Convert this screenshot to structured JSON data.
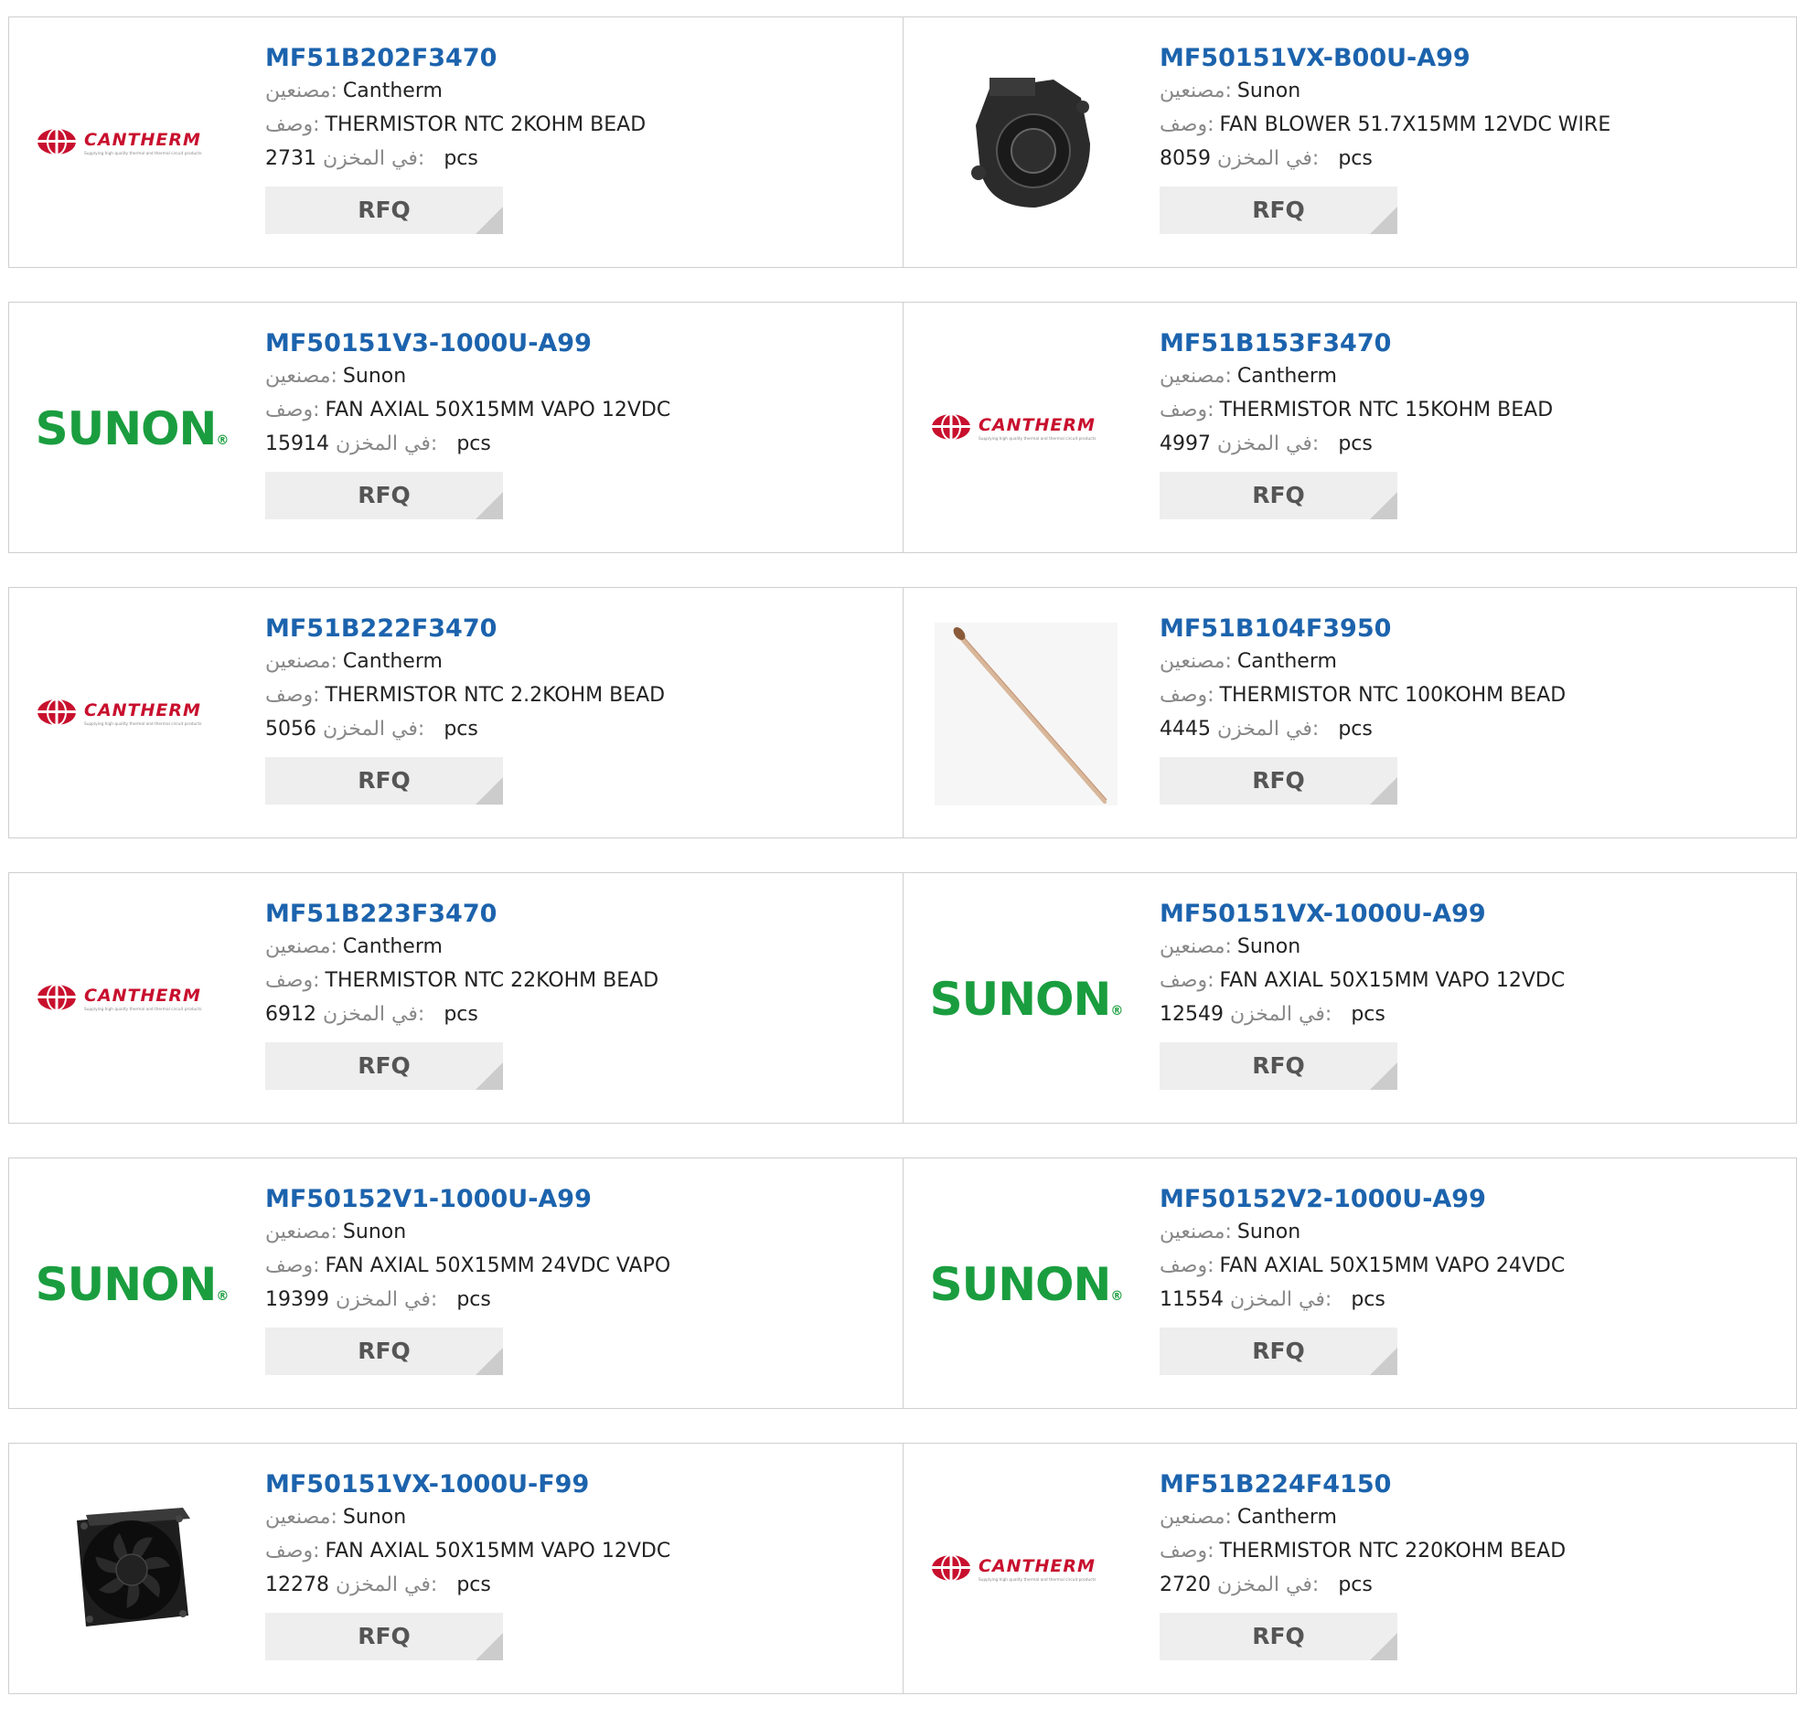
{
  "labels": {
    "manufacturer": "مصنعين:",
    "description": "وصف:",
    "in_stock": "في المخزن:",
    "unit": "pcs",
    "rfq": "RFQ"
  },
  "colors": {
    "part_link": "#1c63ad",
    "sunon_green": "#1a9d3f",
    "cantherm_red": "#c8102e",
    "button_bg": "#eeeeee",
    "border": "#cfcfcf"
  },
  "products": [
    {
      "part": "MF51B202F3470",
      "manufacturer": "Cantherm",
      "description": "THERMISTOR NTC 2KOHM BEAD",
      "stock": "2731",
      "image": "cantherm-logo"
    },
    {
      "part": "MF50151VX-B00U-A99",
      "manufacturer": "Sunon",
      "description": "FAN BLOWER 51.7X15MM 12VDC WIRE",
      "stock": "8059",
      "image": "blower-fan-photo"
    },
    {
      "part": "MF50151V3-1000U-A99",
      "manufacturer": "Sunon",
      "description": "FAN AXIAL 50X15MM VAPO 12VDC",
      "stock": "15914",
      "image": "sunon-logo"
    },
    {
      "part": "MF51B153F3470",
      "manufacturer": "Cantherm",
      "description": "THERMISTOR NTC 15KOHM BEAD",
      "stock": "4997",
      "image": "cantherm-logo"
    },
    {
      "part": "MF51B222F3470",
      "manufacturer": "Cantherm",
      "description": "THERMISTOR NTC 2.2KOHM BEAD",
      "stock": "5056",
      "image": "cantherm-logo"
    },
    {
      "part": "MF51B104F3950",
      "manufacturer": "Cantherm",
      "description": "THERMISTOR NTC 100KOHM BEAD",
      "stock": "4445",
      "image": "thermistor-bead-photo"
    },
    {
      "part": "MF51B223F3470",
      "manufacturer": "Cantherm",
      "description": "THERMISTOR NTC 22KOHM BEAD",
      "stock": "6912",
      "image": "cantherm-logo"
    },
    {
      "part": "MF50151VX-1000U-A99",
      "manufacturer": "Sunon",
      "description": "FAN AXIAL 50X15MM VAPO 12VDC",
      "stock": "12549",
      "image": "sunon-logo"
    },
    {
      "part": "MF50152V1-1000U-A99",
      "manufacturer": "Sunon",
      "description": "FAN AXIAL 50X15MM 24VDC VAPO",
      "stock": "19399",
      "image": "sunon-logo"
    },
    {
      "part": "MF50152V2-1000U-A99",
      "manufacturer": "Sunon",
      "description": "FAN AXIAL 50X15MM VAPO 24VDC",
      "stock": "11554",
      "image": "sunon-logo"
    },
    {
      "part": "MF50151VX-1000U-F99",
      "manufacturer": "Sunon",
      "description": "FAN AXIAL 50X15MM VAPO 12VDC",
      "stock": "12278",
      "image": "axial-fan-photo"
    },
    {
      "part": "MF51B224F4150",
      "manufacturer": "Cantherm",
      "description": "THERMISTOR NTC 220KOHM BEAD",
      "stock": "2720",
      "image": "cantherm-logo"
    }
  ],
  "logos": {
    "sunon_text": "SUNON",
    "sunon_mark": "®",
    "cantherm_text": "CANTHERM",
    "cantherm_tagline": "Supplying high quality thermal and thermal circuit products"
  }
}
